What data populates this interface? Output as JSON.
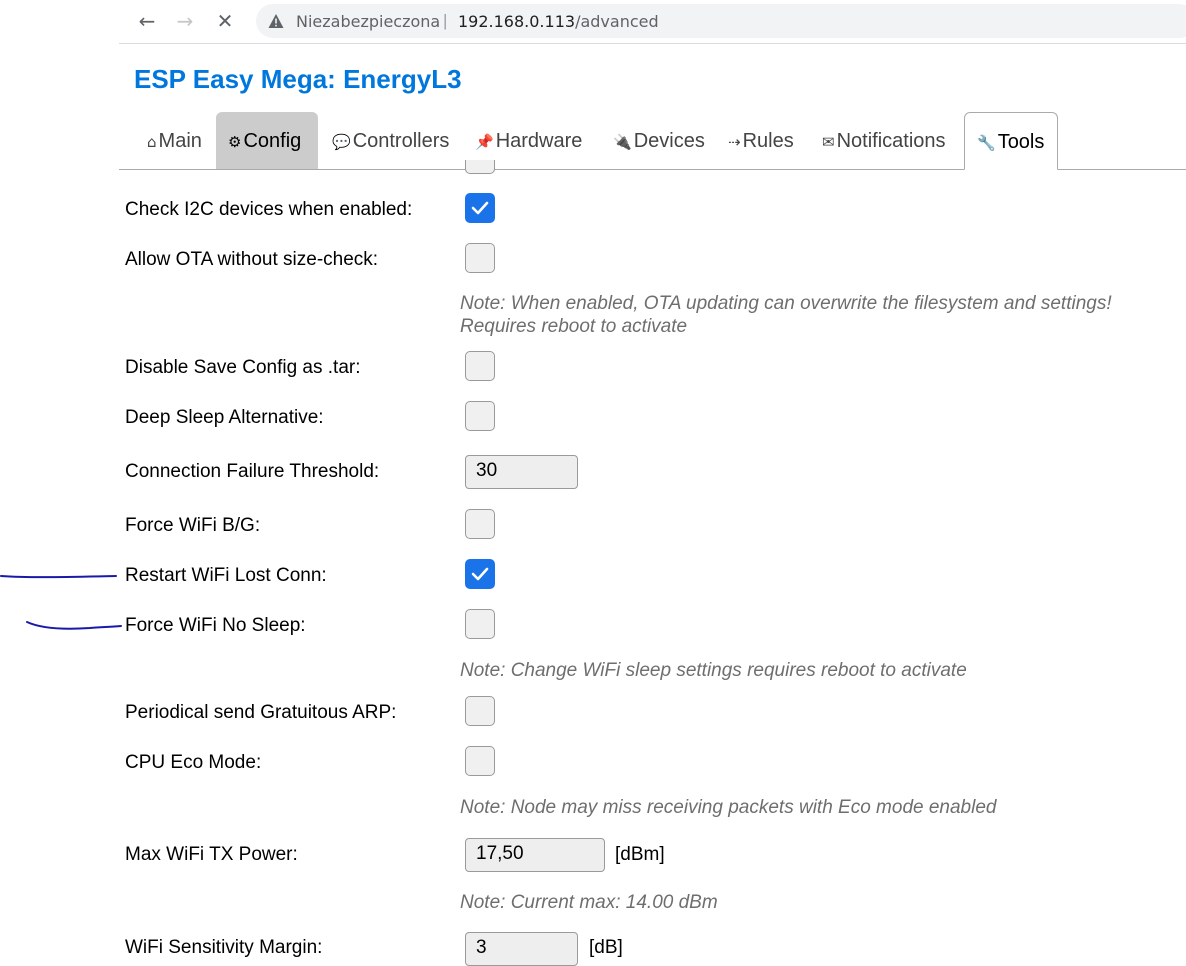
{
  "browser": {
    "back_icon": "←",
    "forward_icon": "→",
    "stop_icon": "✕",
    "security_label": "Niezabezpieczona",
    "separator": "|",
    "url_host": "192.168.0.113",
    "url_path": "/advanced"
  },
  "page": {
    "title": "ESP Easy Mega: EnergyL3"
  },
  "menu": {
    "main": {
      "icon": "⌂",
      "label": "Main"
    },
    "config": {
      "icon": "⚙",
      "label": "Config"
    },
    "controllers": {
      "icon": "💬",
      "label": "Controllers"
    },
    "hardware": {
      "icon": "📌",
      "label": "Hardware"
    },
    "devices": {
      "icon": "🔌",
      "label": "Devices"
    },
    "rules": {
      "icon": "⇢",
      "label": "Rules"
    },
    "notifications": {
      "icon": "✉",
      "label": "Notifications"
    },
    "tools": {
      "icon": "🔧",
      "label": "Tools"
    }
  },
  "form": {
    "check_i2c": {
      "label": "Check I2C devices when enabled:",
      "checked": true
    },
    "allow_ota": {
      "label": "Allow OTA without size-check:",
      "checked": false
    },
    "ota_note_line1": "Note: When enabled, OTA updating can overwrite the filesystem and settings!",
    "ota_note_line2": "Requires reboot to activate",
    "disable_save_tar": {
      "label": "Disable Save Config as .tar:",
      "checked": false
    },
    "deep_sleep_alt": {
      "label": "Deep Sleep Alternative:",
      "checked": false
    },
    "conn_fail_threshold": {
      "label": "Connection Failure Threshold:",
      "value": "30"
    },
    "force_wifi_bg": {
      "label": "Force WiFi B/G:",
      "checked": false
    },
    "restart_wifi_lost": {
      "label": "Restart WiFi Lost Conn:",
      "checked": true
    },
    "force_wifi_no_sleep": {
      "label": "Force WiFi No Sleep:",
      "checked": false
    },
    "wifi_sleep_note": "Note: Change WiFi sleep settings requires reboot to activate",
    "gratuitous_arp": {
      "label": "Periodical send Gratuitous ARP:",
      "checked": false
    },
    "cpu_eco": {
      "label": "CPU Eco Mode:",
      "checked": false
    },
    "eco_note": "Note: Node may miss receiving packets with Eco mode enabled",
    "max_tx_power": {
      "label": "Max WiFi TX Power:",
      "value": "17,50",
      "unit": "[dBm]"
    },
    "tx_power_note": "Note: Current max: 14.00 dBm",
    "sensitivity_margin": {
      "label": "WiFi Sensitivity Margin:",
      "value": "3",
      "unit": "[dB]"
    }
  },
  "colors": {
    "title": "#0077dd",
    "checkbox_checked": "#1a73e8",
    "annotation_pen": "#1a1aa8"
  }
}
